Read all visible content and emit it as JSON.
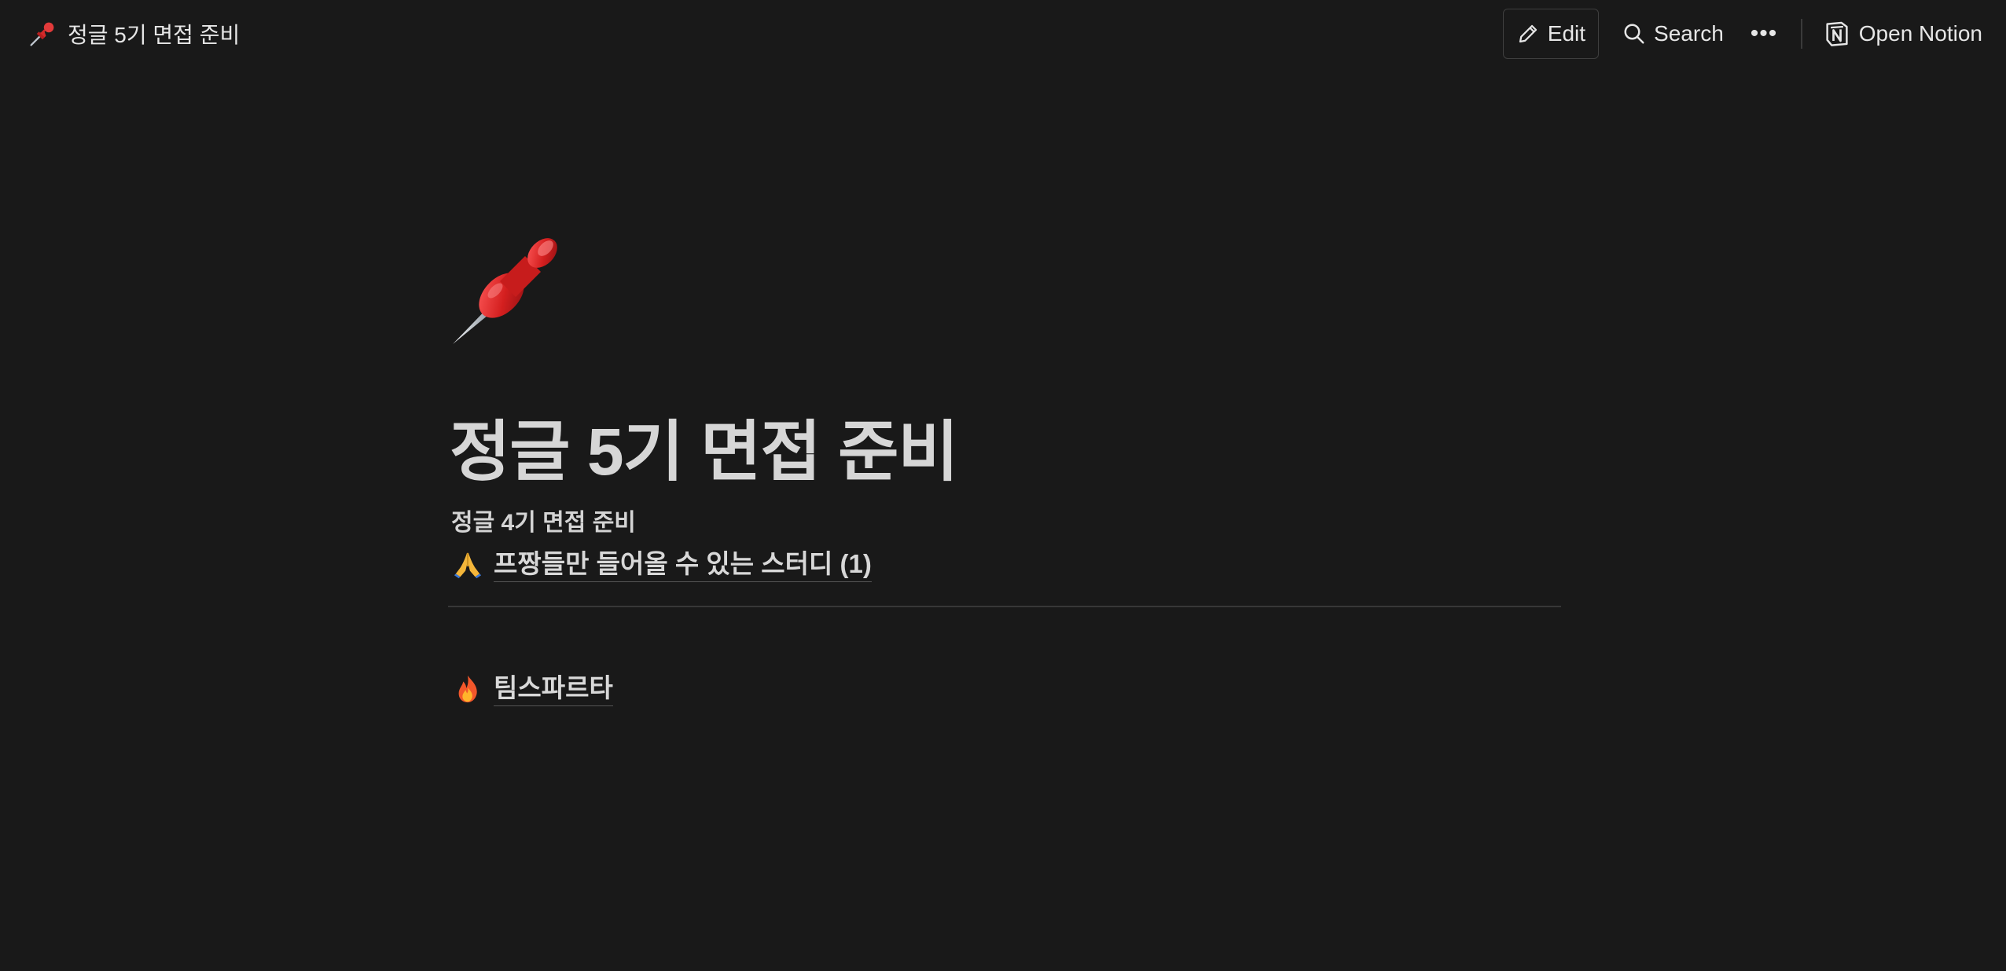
{
  "breadcrumb": {
    "icon": "pushpin-icon",
    "title": "정글 5기 면접 준비"
  },
  "actions": {
    "edit_label": "Edit",
    "search_label": "Search",
    "more_label": "•••",
    "open_notion_label": "Open Notion"
  },
  "page": {
    "icon": "pushpin-icon",
    "title": "정글 5기 면접 준비",
    "subheading": "정글 4기 면접 준비",
    "links": [
      {
        "icon": "folded-hands-icon",
        "label": "프짱들만 들어올 수 있는 스터디 (1)"
      },
      {
        "icon": "fire-icon",
        "label": "팀스파르타"
      }
    ]
  },
  "colors": {
    "background": "#191919",
    "text": "#d4d4d4",
    "accent_pin": "#e03131"
  }
}
